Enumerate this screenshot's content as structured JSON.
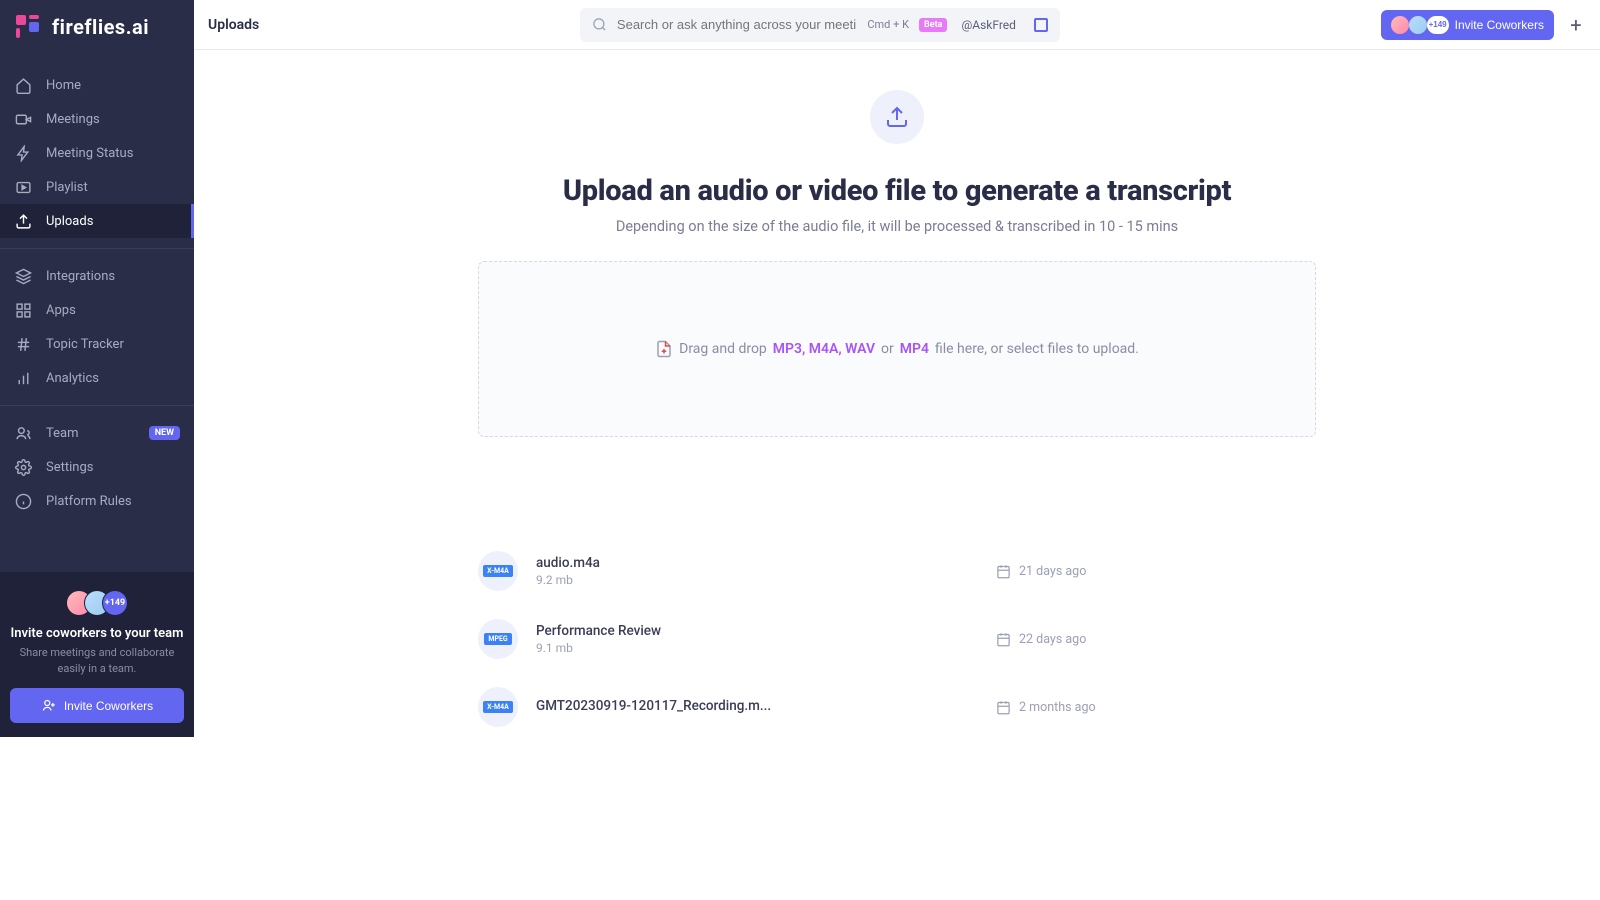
{
  "brand": "fireflies.ai",
  "header": {
    "title": "Uploads",
    "search_placeholder": "Search or ask anything across your meetings...",
    "kbd": "Cmd + K",
    "beta": "Beta",
    "askfred": "@AskFred",
    "invite_label": "Invite Coworkers",
    "invite_count": "+149"
  },
  "sidebar": {
    "items": [
      {
        "label": "Home"
      },
      {
        "label": "Meetings"
      },
      {
        "label": "Meeting Status"
      },
      {
        "label": "Playlist"
      },
      {
        "label": "Uploads"
      }
    ],
    "items2": [
      {
        "label": "Integrations"
      },
      {
        "label": "Apps"
      },
      {
        "label": "Topic Tracker"
      },
      {
        "label": "Analytics"
      }
    ],
    "items3": [
      {
        "label": "Team",
        "badge": "NEW"
      },
      {
        "label": "Settings"
      },
      {
        "label": "Platform Rules"
      }
    ],
    "footer": {
      "title": "Invite coworkers to your team",
      "sub": "Share meetings and collaborate easily in a team.",
      "button": "Invite Coworkers",
      "count": "+149"
    }
  },
  "upload": {
    "title": "Upload an audio or video file to generate a transcript",
    "sub": "Depending on the size of the audio file, it will be processed & transcribed in 10 - 15 mins",
    "dz_pre": "Drag and drop",
    "dz_formats1": "MP3, M4A, WAV",
    "dz_or": "or",
    "dz_formats2": "MP4",
    "dz_post": "file here, or select files to upload."
  },
  "files": [
    {
      "name": "audio.m4a",
      "size": "9.2 mb",
      "date": "21 days ago",
      "badge": "X-M4A"
    },
    {
      "name": "Performance Review",
      "size": "9.1 mb",
      "date": "22 days ago",
      "badge": "MPEG"
    },
    {
      "name": "GMT20230919-120117_Recording.m...",
      "size": "",
      "date": "2 months ago",
      "badge": "X-M4A"
    }
  ]
}
